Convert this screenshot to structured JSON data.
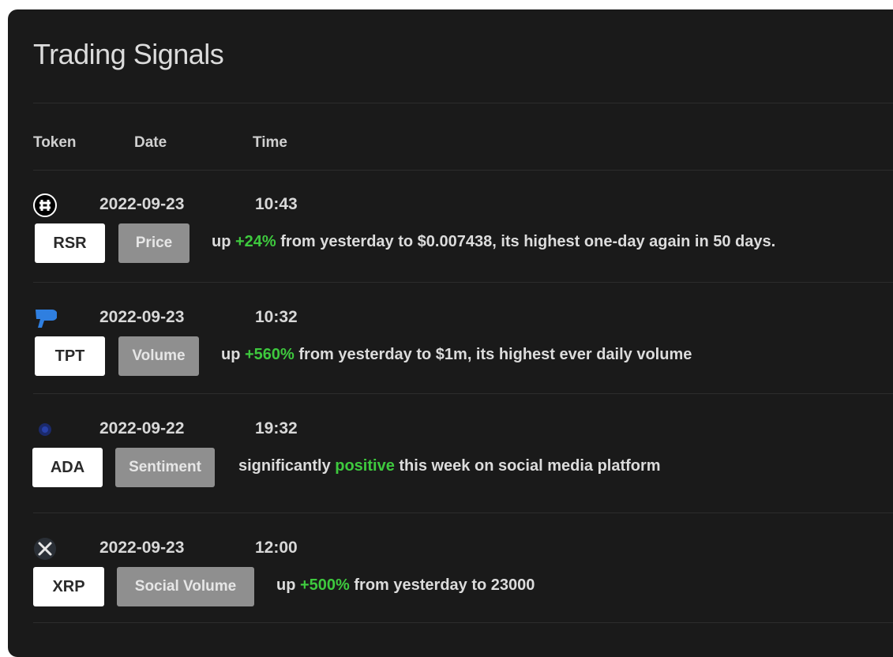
{
  "panel": {
    "title": "Trading Signals"
  },
  "columns": {
    "token": "Token",
    "date": "Date",
    "time": "Time"
  },
  "colors": {
    "positive": "#3ec93e",
    "background": "#1a1a1a"
  },
  "signals": [
    {
      "icon": "reserve-rights-icon",
      "date": "2022-09-23",
      "time": "10:43",
      "token": "RSR",
      "type": "Price",
      "pre": "up ",
      "highlight": "+24%",
      "post": " from yesterday to $0.007438, its highest one-day again in 50 days."
    },
    {
      "icon": "tpt-icon",
      "date": "2022-09-23",
      "time": "10:32",
      "token": "TPT",
      "type": "Volume",
      "pre": "up ",
      "highlight": "+560%",
      "post": " from yesterday to $1m, its highest ever daily volume"
    },
    {
      "icon": "cardano-icon",
      "date": "2022-09-22",
      "time": "19:32",
      "token": "ADA",
      "type": "Sentiment",
      "pre": "significantly ",
      "highlight": "positive",
      "post": " this week on social media platform"
    },
    {
      "icon": "xrp-icon",
      "date": "2022-09-23",
      "time": "12:00",
      "token": "XRP",
      "type": "Social Volume",
      "pre": "up ",
      "highlight": "+500%",
      "post": " from yesterday to 23000"
    }
  ]
}
